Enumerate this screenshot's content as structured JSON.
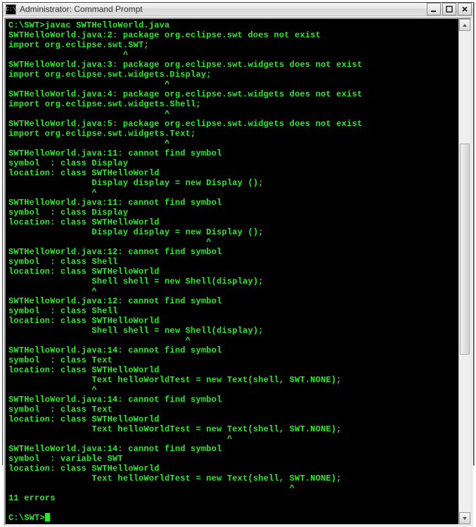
{
  "window": {
    "title": "Administrator: Command Prompt",
    "icon_label": "cmd-icon"
  },
  "controls": {
    "minimize": "minimize",
    "maximize": "maximize",
    "close": "close"
  },
  "console": {
    "prompt1": "C:\\SWT>javac SWTHelloWorld.java",
    "err1a": "SWTHelloWorld.java:2: package org.eclipse.swt does not exist",
    "err1b": "import org.eclipse.swt.SWT;",
    "caret1": "                      ^",
    "err2a": "SWTHelloWorld.java:3: package org.eclipse.swt.widgets does not exist",
    "err2b": "import org.eclipse.swt.widgets.Display;",
    "caret2": "                              ^",
    "err3a": "SWTHelloWorld.java:4: package org.eclipse.swt.widgets does not exist",
    "err3b": "import org.eclipse.swt.widgets.Shell;",
    "caret3": "                              ^",
    "err4a": "SWTHelloWorld.java:5: package org.eclipse.swt.widgets does not exist",
    "err4b": "import org.eclipse.swt.widgets.Text;",
    "caret4": "                              ^",
    "err5a": "SWTHelloWorld.java:11: cannot find symbol",
    "err5b": "symbol  : class Display",
    "err5c": "location: class SWTHelloWorld",
    "err5d": "                Display display = new Display ();",
    "caret5": "                ^",
    "err6a": "SWTHelloWorld.java:11: cannot find symbol",
    "err6b": "symbol  : class Display",
    "err6c": "location: class SWTHelloWorld",
    "err6d": "                Display display = new Display ();",
    "caret6": "                                      ^",
    "err7a": "SWTHelloWorld.java:12: cannot find symbol",
    "err7b": "symbol  : class Shell",
    "err7c": "location: class SWTHelloWorld",
    "err7d": "                Shell shell = new Shell(display);",
    "caret7": "                ^",
    "err8a": "SWTHelloWorld.java:12: cannot find symbol",
    "err8b": "symbol  : class Shell",
    "err8c": "location: class SWTHelloWorld",
    "err8d": "                Shell shell = new Shell(display);",
    "caret8": "                                  ^",
    "err9a": "SWTHelloWorld.java:14: cannot find symbol",
    "err9b": "symbol  : class Text",
    "err9c": "location: class SWTHelloWorld",
    "err9d": "                Text helloWorldTest = new Text(shell, SWT.NONE);",
    "caret9": "                ^",
    "err10a": "SWTHelloWorld.java:14: cannot find symbol",
    "err10b": "symbol  : class Text",
    "err10c": "location: class SWTHelloWorld",
    "err10d": "                Text helloWorldTest = new Text(shell, SWT.NONE);",
    "caret10": "                                          ^",
    "err11a": "SWTHelloWorld.java:14: cannot find symbol",
    "err11b": "symbol  : variable SWT",
    "err11c": "location: class SWTHelloWorld",
    "err11d": "                Text helloWorldTest = new Text(shell, SWT.NONE);",
    "caret11": "                                                      ^",
    "summary": "11 errors",
    "prompt2": "C:\\SWT>"
  }
}
